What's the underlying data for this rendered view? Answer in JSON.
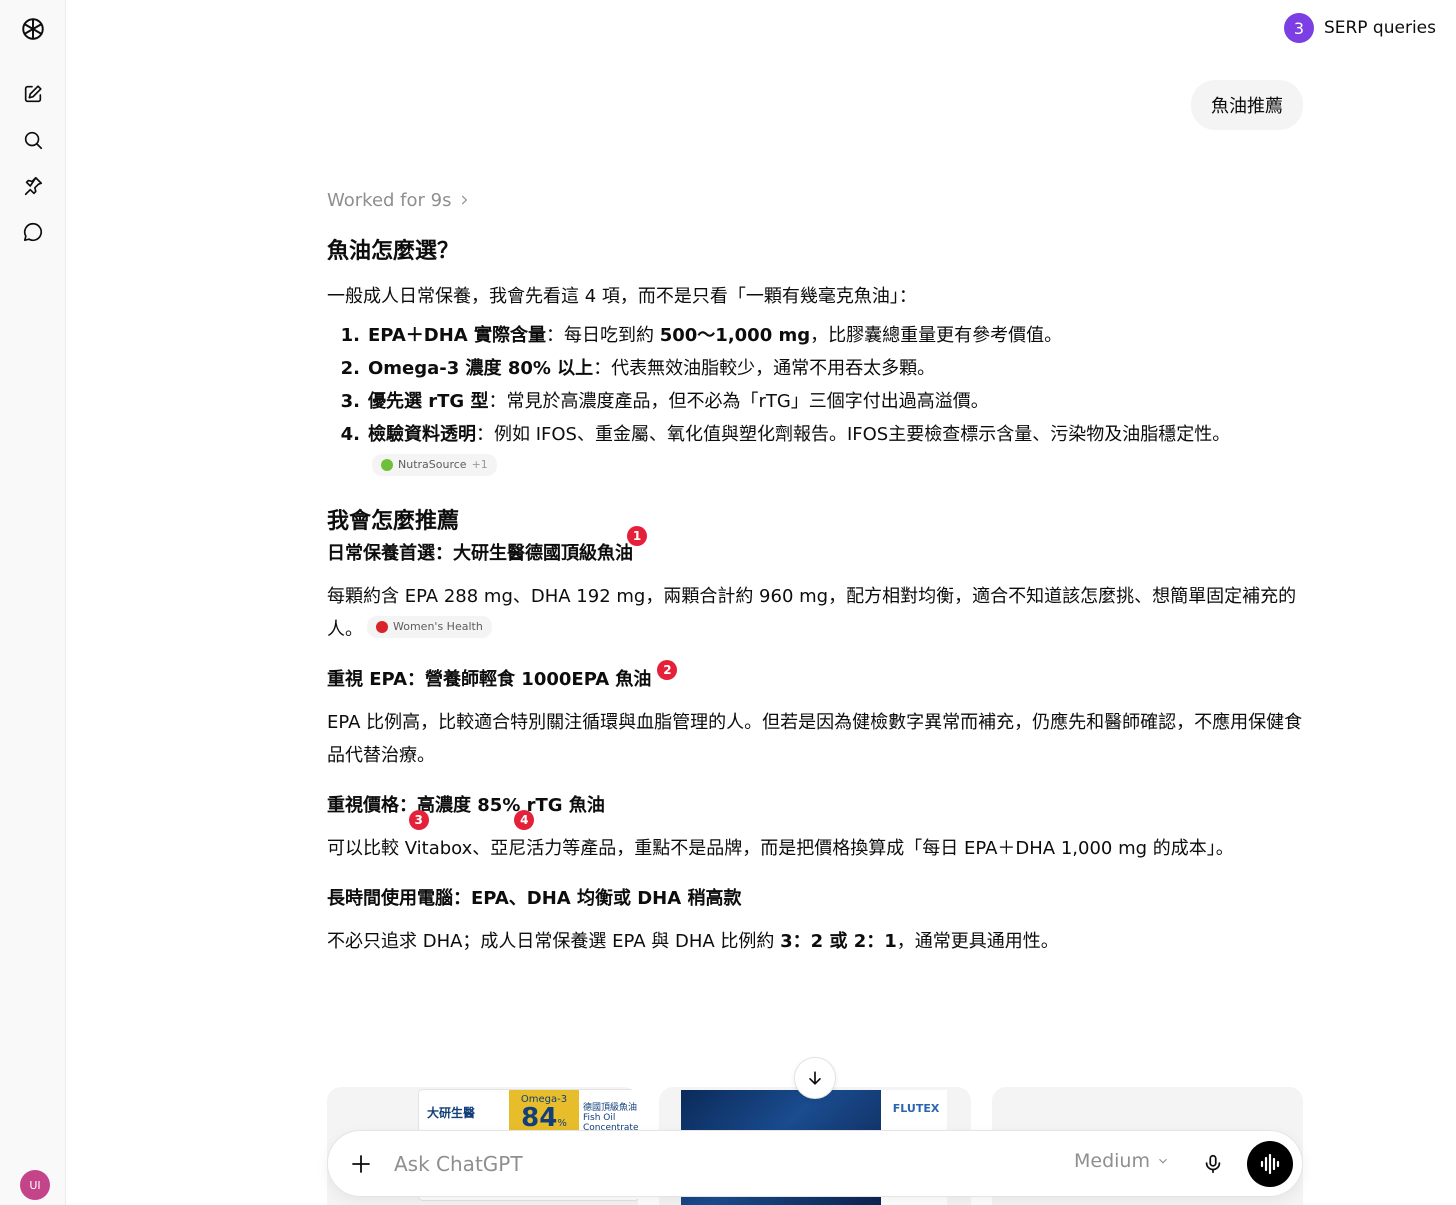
{
  "sidebar": {
    "icons": [
      "openai-logo-icon",
      "new-chat-icon",
      "search-icon",
      "pin-icon",
      "chat-icon"
    ],
    "avatar_initials": "UI"
  },
  "serp": {
    "count": "3",
    "label": "SERP queries"
  },
  "user_message": "魚油推薦",
  "worked_label": "Worked for 9s",
  "section1": {
    "title": "魚油怎麼選？",
    "intro": "一般成人日常保養，我會先看這 4 項，而不是只看「一顆有幾毫克魚油」：",
    "items": [
      {
        "num": "1.",
        "bold": "EPA＋DHA 實際含量",
        "text_pre": "：每日吃到約 ",
        "bold2": "500～1,000 mg",
        "text_post": "，比膠囊總重量更有參考價值。"
      },
      {
        "num": "2.",
        "bold": "Omega-3 濃度 80% 以上",
        "text": "：代表無效油脂較少，通常不用吞太多顆。"
      },
      {
        "num": "3.",
        "bold": "優先選 rTG 型",
        "text": "：常見於高濃度產品，但不必為「rTG」三個字付出過高溢價。"
      },
      {
        "num": "4.",
        "bold": "檢驗資料透明",
        "text": "：例如 IFOS、重金屬、氧化值與塑化劑報告。IFOS主要檢查標示含量、污染物及油脂穩定性。",
        "cite_label": "NutraSource",
        "cite_extra": "+1"
      }
    ]
  },
  "section2": {
    "title": "我會怎麼推薦",
    "recs": [
      {
        "heading": "日常保養首選：大研生醫德國頂級魚油",
        "marker": "1",
        "body": "每顆約含 EPA 288 mg、DHA 192 mg，兩顆合計約 960 mg，配方相對均衡，適合不知道該怎麼挑、想簡單固定補充的人。",
        "cite_label": "Women's Health"
      },
      {
        "heading": "重視 EPA：營養師輕食 1000EPA 魚油",
        "marker": "2",
        "body": "EPA 比例高，比較適合特別關注循環與血脂管理的人。但若是因為健檢數字異常而補充，仍應先和醫師確認，不應用保健食品代替治療。"
      },
      {
        "heading": "重視價格：高濃度 85% rTG 魚油",
        "body_pre": "可以比較 ",
        "brand1": "Vitabox",
        "marker1": "3",
        "sep": "、",
        "brand2": "亞尼活力",
        "marker2": "4",
        "body_post": "等產品，重點不是品牌，而是把價格換算成「每日 EPA＋DHA 1,000 mg 的成本」。"
      },
      {
        "heading": "長時間使用電腦：EPA、DHA 均衡或 DHA 稍高款",
        "body_pre": "不必只追求 DHA；成人日常保養選 EPA 與 DHA 比例約 ",
        "bold": "3：2 或 2：1",
        "body_post": "，通常更具通用性。"
      }
    ]
  },
  "cards": {
    "card1": {
      "brand": "大研生醫",
      "tag_top": "Omega-3",
      "tag_big": "84",
      "tag_unit": "%",
      "right_line1": "德國頂級魚油",
      "right_line2": "Fish Oil Concentrate"
    },
    "card2": {
      "logo": "FLUTEX"
    }
  },
  "composer": {
    "placeholder": "Ask ChatGPT",
    "model_label": "Medium"
  }
}
